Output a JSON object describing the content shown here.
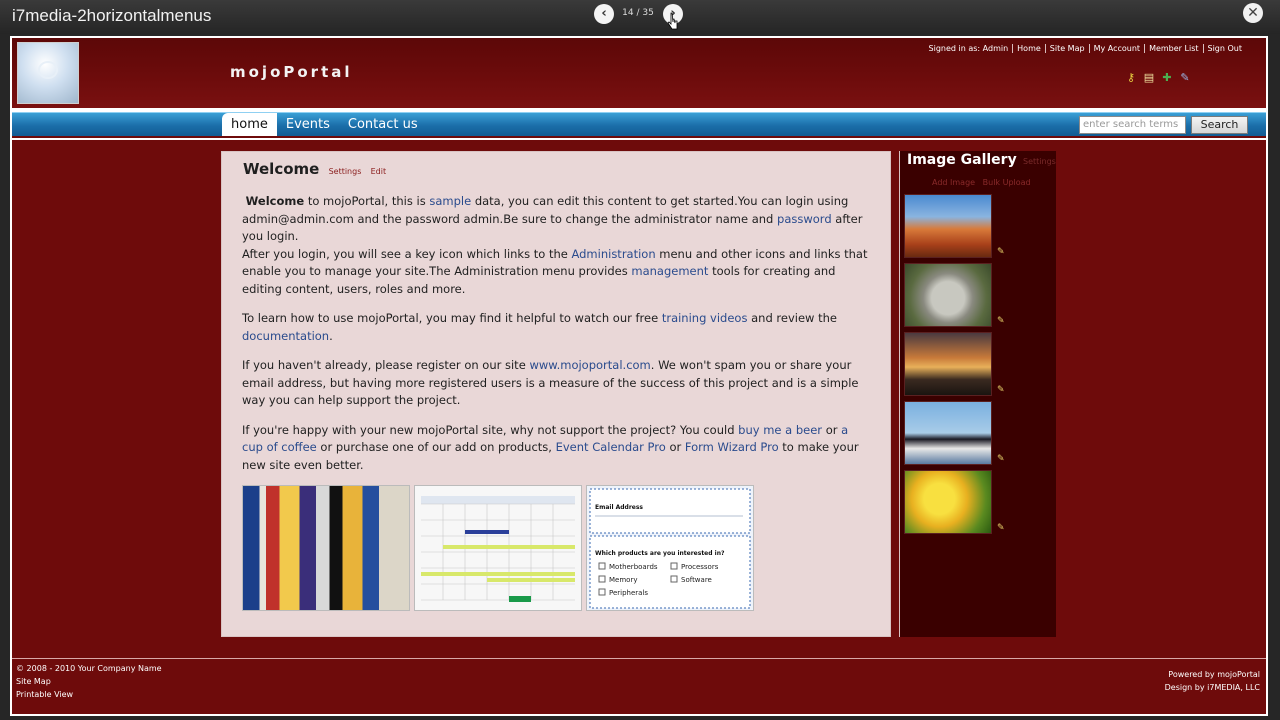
{
  "viewer": {
    "title": "i7media-2horizontalmenus",
    "counter": "14 / 35"
  },
  "header": {
    "site_name": "mojoPortal",
    "top_links": [
      "Signed in as: Admin",
      "Home",
      "Site Map",
      "My Account",
      "Member List",
      "Sign Out"
    ]
  },
  "menu": {
    "items": [
      "home",
      "Events",
      "Contact us"
    ],
    "active": "home",
    "search_placeholder": "enter search terms",
    "search_button": "Search"
  },
  "content": {
    "title": "Welcome",
    "settings_link": "Settings",
    "edit_link": "Edit",
    "p1_bold": "Welcome",
    "p1_a": " to mojoPortal, this is ",
    "p1_link1": "sample",
    "p1_b": " data, you can edit this content to get started.You can login using admin@admin.com and the password admin.Be sure to change the administrator name and ",
    "p1_link2": "password",
    "p1_c": " after you login.",
    "p2_a": "After you login, you will see a key icon which links to the ",
    "p2_link1": "Administration",
    "p2_b": " menu and other icons and links that enable you to manage your site.The Administration menu provides ",
    "p2_link2": "management",
    "p2_c": " tools for creating and editing content, users, roles and more.",
    "p3_a": "To learn how to use mojoPortal, you may find it helpful to watch our free ",
    "p3_link1": "training videos",
    "p3_b": " and review the ",
    "p3_link2": "documentation",
    "p3_c": ".",
    "p4_a": "If you haven't already, please register on our site ",
    "p4_link1": "www.mojoportal.com",
    "p4_b": ". We won't spam you or share your email address, but having more registered users is a measure of the success of this project and is a simple way you can help support the project.",
    "p5_a": "If you're happy with your new mojoPortal site, why not support the project? You could ",
    "p5_link1": "buy me a beer",
    "p5_b": " or ",
    "p5_link2": "a cup of coffee",
    "p5_c": " or purchase one of our add on products, ",
    "p5_link3": "Event Calendar Pro",
    "p5_d": " or ",
    "p5_link4": "Form Wizard Pro",
    "p5_e": " to make your new site even better.",
    "form_email_label": "Email Address",
    "form_question": "Which products are you interested in?",
    "form_options": [
      "Motherboards",
      "Processors",
      "Memory",
      "Software",
      "Peripherals"
    ]
  },
  "gallery": {
    "title": "Image Gallery",
    "settings_link": "Settings",
    "add_image": "Add Image",
    "bulk_upload": "Bulk Upload"
  },
  "footer": {
    "copyright": "© 2008 - 2010 Your Company Name",
    "site_map": "Site Map",
    "printable_view": "Printable View",
    "powered_by": "Powered by mojoPortal",
    "design_by": "Design by i7MEDIA, LLC"
  }
}
